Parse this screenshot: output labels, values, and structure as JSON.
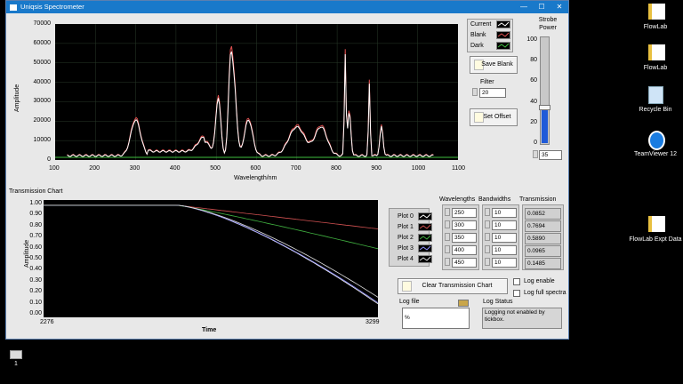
{
  "window": {
    "title": "Uniqsis Spectrometer",
    "minimize": "—",
    "maximize": "☐",
    "close": "✕"
  },
  "spectrum": {
    "ylabel": "Amplitude",
    "xlabel": "Wavelength/nm",
    "y_ticks": [
      "70000",
      "60000",
      "50000",
      "40000",
      "30000",
      "20000",
      "10000",
      "0"
    ],
    "x_ticks": [
      "100",
      "200",
      "300",
      "400",
      "500",
      "600",
      "700",
      "800",
      "900",
      "1000",
      "1100"
    ],
    "legend": [
      "Current",
      "Blank",
      "Dark"
    ],
    "colors": {
      "current": "#ffffff",
      "blank": "#e05050",
      "dark": "#40c040"
    }
  },
  "controls": {
    "save_blank": "Save Blank",
    "filter_label": "Filter",
    "filter_value": "20",
    "set_offset": "Set Offset",
    "strobe_label": "Strobe Power",
    "strobe_ticks": [
      "100",
      "80",
      "60",
      "40",
      "20",
      "0"
    ],
    "strobe_value": "35",
    "strobe_level": 0.35
  },
  "transmission": {
    "title": "Transmission Chart",
    "ylabel": "Amplitude",
    "xlabel": "Time",
    "x_start": "2276",
    "x_end": "3299",
    "y_ticks": [
      "1.00",
      "0.90",
      "0.80",
      "0.70",
      "0.60",
      "0.50",
      "0.40",
      "0.30",
      "0.20",
      "0.10",
      "0.00"
    ],
    "plots": [
      "Plot 0",
      "Plot 1",
      "Plot 2",
      "Plot 3",
      "Plot 4"
    ],
    "wavelengths_label": "Wavelengths",
    "bandwidths_label": "Bandwidths",
    "transmission_label": "Transmission",
    "wavelengths": [
      "250",
      "300",
      "350",
      "400",
      "450"
    ],
    "bandwidths": [
      "10",
      "10",
      "10",
      "10",
      "10"
    ],
    "values": [
      "0.0852",
      "0.7694",
      "0.5890",
      "0.0965",
      "0.1485"
    ],
    "clear_button": "Clear Transmission Chart",
    "log_enable": "Log enable",
    "log_full": "Log full spectra",
    "log_file_label": "Log file",
    "log_file_value": "%",
    "log_status_label": "Log Status",
    "log_status_text": "Logging not enabled by tickbox."
  },
  "desktop": [
    {
      "label": "FlowLab",
      "icon": "file-icon"
    },
    {
      "label": "FlowLab",
      "icon": "file-icon"
    },
    {
      "label": "Recycle Bin",
      "icon": "recycle-bin-icon"
    },
    {
      "label": "TeamViewer 12",
      "icon": "teamviewer-icon"
    },
    {
      "label": "FlowLab Expt Data",
      "icon": "file-icon"
    }
  ],
  "taskbar": {
    "item_count": "1"
  }
}
